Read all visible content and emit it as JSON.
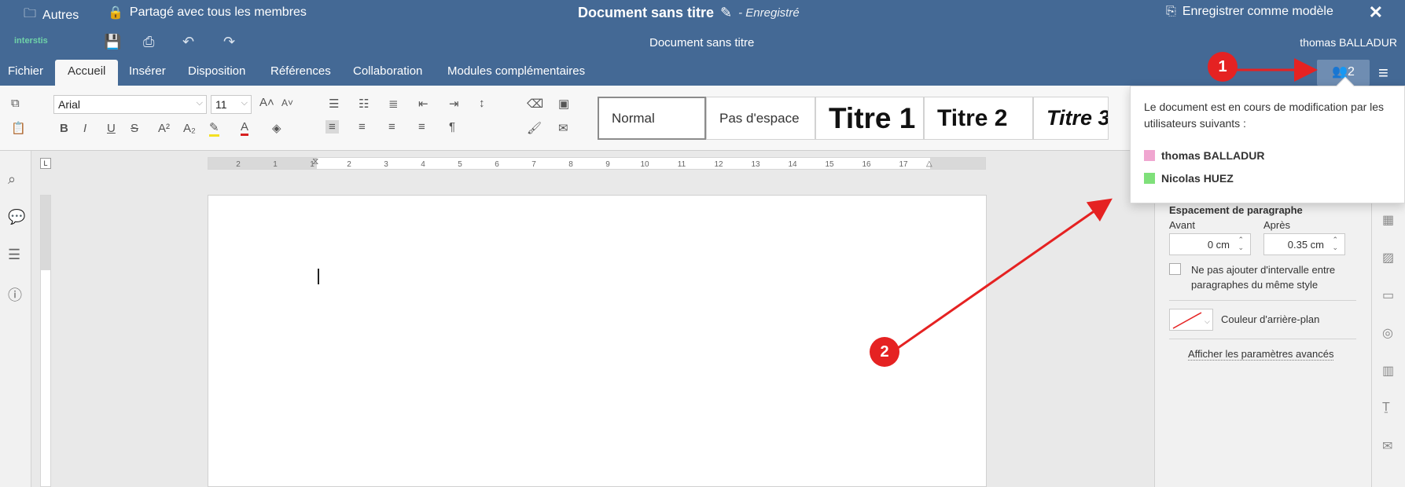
{
  "topbar": {
    "folder_label": "Autres",
    "share_label": "Partagé avec tous les membres",
    "doc_title": "Document sans titre",
    "saved_status": "- Enregistré",
    "save_template_label": "Enregistrer comme modèle",
    "close_label": "✕"
  },
  "appbar": {
    "logo_text": "interstis",
    "doc_title": "Document sans titre",
    "user_name": "thomas BALLADUR"
  },
  "tabs": [
    "Fichier",
    "Accueil",
    "Insérer",
    "Disposition",
    "Références",
    "Collaboration",
    "Modules complémentaires"
  ],
  "active_tab": "Accueil",
  "collab_button": {
    "count": "2"
  },
  "toolbar": {
    "font_name": "Arial",
    "font_size": "11",
    "styles": [
      "Normal",
      "Pas d'espace",
      "Titre 1",
      "Titre 2",
      "Titre 3"
    ]
  },
  "popover": {
    "message": "Le document est en cours de modification par les utilisateurs suivants :",
    "users": [
      {
        "name": "thomas BALLADUR",
        "color": "#f0a6d0"
      },
      {
        "name": "Nicolas HUEZ",
        "color": "#7fe07a"
      }
    ]
  },
  "right_panel": {
    "section_title": "Espacement de paragraphe",
    "before_label": "Avant",
    "after_label": "Après",
    "before_value": "0 cm",
    "after_value": "0.35 cm",
    "checkbox_label": "Ne pas ajouter d'intervalle entre paragraphes du même style",
    "bg_color_label": "Couleur d'arrière-plan",
    "advanced_link": "Afficher les paramètres avancés"
  },
  "ruler": {
    "h_ticks": [
      "2",
      "1",
      "1",
      "2",
      "3",
      "4",
      "5",
      "6",
      "7",
      "8",
      "9",
      "10",
      "11",
      "12",
      "13",
      "14",
      "15",
      "16",
      "17"
    ],
    "corner_label": "L"
  },
  "annotations": [
    {
      "label": "1"
    },
    {
      "label": "2"
    }
  ],
  "colors": {
    "header_blue": "#446995",
    "annotation_red": "#e52222"
  }
}
